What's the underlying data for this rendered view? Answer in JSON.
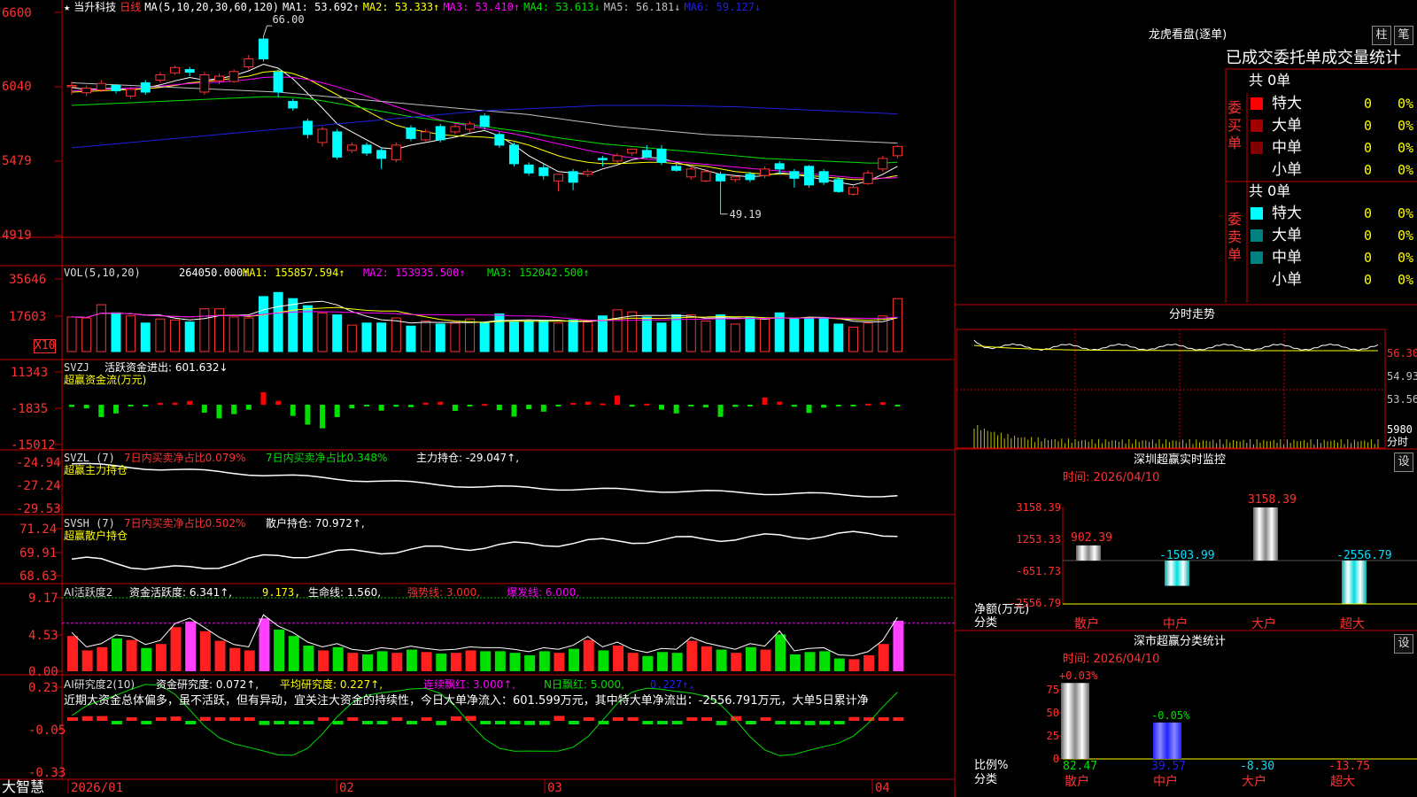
{
  "colors": {
    "up": "#ff3232",
    "down": "#00ffff",
    "ma1": "#ffffff",
    "ma2": "#ffff00",
    "ma3": "#ff00ff",
    "ma4": "#00e000",
    "ma5": "#c0c0c0",
    "ma6": "#2020e0",
    "grid": "#c00000",
    "label": "#ff3232"
  },
  "main_header": {
    "star": "★",
    "stock": "当升科技",
    "period": "日线",
    "ma_params": "MA(5,10,20,30,60,120)",
    "ma1": "MA1: 53.692↑",
    "ma2": "MA2: 53.333↑",
    "ma3": "MA3: 53.410↑",
    "ma4": "MA4: 53.613↓",
    "ma5": "MA5: 56.181↓",
    "ma6": "MA6: 59.127↓",
    "high_mark": "66.00",
    "low_mark": "49.19"
  },
  "vol_header": {
    "name": "VOL(5,10,20)",
    "v": "264050.000↑",
    "ma1": "MA1: 155857.594↑",
    "ma2": "MA2: 153935.500↑",
    "ma3": "MA3: 152042.500↑",
    "unit": "X10"
  },
  "svzj_header": {
    "name": "SVZJ",
    "label": "活跃资金进出: 601.632↓",
    "sub": "超赢资金流(万元)"
  },
  "svzl_header": {
    "name": "SVZL (7)",
    "a": "7日内买卖净占比0.079%",
    "b": "7日内买卖净占比0.348%",
    "c": "主力持仓: -29.047↑,",
    "sub": "超赢主力持仓"
  },
  "svsh_header": {
    "name": "SVSH (7)",
    "a": "7日内买卖净占比0.502%",
    "c": "散户持仓: 70.972↑,",
    "sub": "超赢散户持仓"
  },
  "ai1_header": {
    "name": "AI活跃度2",
    "a": "资金活跃度: 6.341↑,",
    "b": "9.173,",
    "c": "生命线: 1.560,",
    "d": "强势线: 3.000,",
    "e": "爆发线: 6.000,"
  },
  "ai2_header": {
    "name": "AI研究度2(10)",
    "a": "资金研究度: 0.072↑,",
    "b": "平均研究度: 0.227↑,",
    "c": "连续飘红: 3.000↑,",
    "d": "N日飘红: 5.000,",
    "e": "0.227↑,"
  },
  "ai2_text": "近期大资金总体偏多，虽不活跃，但有异动，宜关注大资金的持续性，今日大单净流入：601.599万元，其中特大单净流出：-2556.791万元，大单5日累计净",
  "y_axes": {
    "main": [
      "6600",
      "6040",
      "5479",
      "4919"
    ],
    "vol": [
      "35646",
      "17603"
    ],
    "svzj": [
      "11343",
      "-1835",
      "-15012"
    ],
    "svzl": [
      "-24.94",
      "-27.24",
      "-29.53"
    ],
    "svsh": [
      "71.24",
      "69.91",
      "68.63"
    ],
    "ai1": [
      "9.17",
      "4.53",
      "0.00"
    ],
    "ai2": [
      "0.23",
      "-0.05",
      "-0.33"
    ]
  },
  "x_axis": {
    "brand": "大智慧",
    "ticks": [
      "2026/01",
      "02",
      "03",
      "04"
    ]
  },
  "lhb": {
    "title": "龙虎看盘(逐单)",
    "btn1": "柱",
    "btn2": "笔",
    "sub": "已成交委托单成交量统计",
    "buy_total": "共 0单",
    "sell_total": "共 0单",
    "buy_label": "委买单",
    "sell_label": "委卖单",
    "rows": [
      {
        "name": "特大",
        "n": "0",
        "p": "0%"
      },
      {
        "name": "大单",
        "n": "0",
        "p": "0%"
      },
      {
        "name": "中单",
        "n": "0",
        "p": "0%"
      },
      {
        "name": "小单",
        "n": "0",
        "p": "0%"
      }
    ]
  },
  "intraday": {
    "title": "分时走势",
    "prices": [
      "56.30",
      "54.93",
      "53.56"
    ],
    "vol": "5980",
    "vol_unit": "分时"
  },
  "sz_monitor": {
    "title": "深圳超赢实时监控",
    "btn": "设",
    "date": "时间: 2026/04/10",
    "ticks": [
      "3158.39",
      "1253.33",
      "-651.73",
      "-2556.79"
    ],
    "y_label": "净额(万元)",
    "x_label": "分类",
    "categories": [
      "散户",
      "中户",
      "大户",
      "超大"
    ],
    "values": [
      902.39,
      -1503.99,
      3158.39,
      -2556.79
    ],
    "value_labels": [
      "902.39",
      "-1503.99",
      "3158.39",
      "-2556.79"
    ]
  },
  "sz_class": {
    "title": "深市超赢分类统计",
    "btn": "设",
    "date": "时间: 2026/04/10",
    "ticks": [
      "75",
      "50",
      "25",
      "0"
    ],
    "y_label": "比例%",
    "x_label": "分类",
    "categories": [
      "散户",
      "中户",
      "大户",
      "超大"
    ],
    "top_labels": [
      "+0.03%",
      "-0.05%"
    ],
    "values": [
      82.47,
      39.57,
      -8.3,
      -13.75
    ],
    "value_labels": [
      "82.47",
      "39.57",
      "-8.30",
      "-13.75"
    ]
  },
  "chart_data": {
    "type": "candlestick",
    "title": "当升科技 日线",
    "ylim": [
      4919,
      6600
    ],
    "x_ticks": [
      "2026/01",
      "02",
      "03",
      "04"
    ],
    "candles": [
      [
        6040,
        6050,
        5980,
        6080
      ],
      [
        5995,
        6030,
        5970,
        6050
      ],
      [
        6015,
        6065,
        6000,
        6090
      ],
      [
        6050,
        6010,
        5990,
        6060
      ],
      [
        5970,
        6020,
        5950,
        6040
      ],
      [
        6070,
        6000,
        5980,
        6090
      ],
      [
        6090,
        6130,
        6070,
        6150
      ],
      [
        6145,
        6185,
        6130,
        6200
      ],
      [
        6170,
        6150,
        6120,
        6190
      ],
      [
        6000,
        6130,
        5980,
        6150
      ],
      [
        6085,
        6120,
        6060,
        6140
      ],
      [
        6080,
        6155,
        6070,
        6170
      ],
      [
        6190,
        6250,
        6170,
        6280
      ],
      [
        6400,
        6250,
        6230,
        6420
      ],
      [
        6150,
        6000,
        5960,
        6170
      ],
      [
        5930,
        5880,
        5860,
        5950
      ],
      [
        5780,
        5680,
        5650,
        5800
      ],
      [
        5620,
        5720,
        5590,
        5740
      ],
      [
        5700,
        5510,
        5490,
        5720
      ],
      [
        5560,
        5600,
        5540,
        5620
      ],
      [
        5600,
        5540,
        5520,
        5620
      ],
      [
        5560,
        5500,
        5420,
        5580
      ],
      [
        5490,
        5600,
        5470,
        5620
      ],
      [
        5730,
        5650,
        5630,
        5750
      ],
      [
        5640,
        5700,
        5630,
        5720
      ],
      [
        5740,
        5640,
        5620,
        5760
      ],
      [
        5700,
        5740,
        5680,
        5760
      ],
      [
        5720,
        5760,
        5700,
        5780
      ],
      [
        5820,
        5740,
        5720,
        5840
      ],
      [
        5680,
        5600,
        5580,
        5700
      ],
      [
        5600,
        5460,
        5440,
        5620
      ],
      [
        5450,
        5390,
        5370,
        5470
      ],
      [
        5430,
        5370,
        5340,
        5460
      ],
      [
        5330,
        5380,
        5250,
        5360
      ],
      [
        5400,
        5320,
        5260,
        5420
      ],
      [
        5380,
        5400,
        5360,
        5420
      ],
      [
        5500,
        5490,
        5440,
        5520
      ],
      [
        5480,
        5520,
        5460,
        5540
      ],
      [
        5540,
        5570,
        5520,
        5560
      ],
      [
        5560,
        5510,
        5500,
        5600
      ],
      [
        5570,
        5470,
        5450,
        5600
      ],
      [
        5440,
        5410,
        5400,
        5460
      ],
      [
        5360,
        5420,
        5340,
        5440
      ],
      [
        5330,
        5400,
        5320,
        5420
      ],
      [
        5380,
        5330,
        5080,
        5400
      ],
      [
        5340,
        5360,
        5320,
        5360
      ],
      [
        5380,
        5340,
        5320,
        5400
      ],
      [
        5370,
        5420,
        5350,
        5440
      ],
      [
        5460,
        5420,
        5380,
        5480
      ],
      [
        5400,
        5350,
        5280,
        5420
      ],
      [
        5440,
        5300,
        5280,
        5450
      ],
      [
        5400,
        5320,
        5300,
        5420
      ],
      [
        5340,
        5250,
        5240,
        5360
      ],
      [
        5230,
        5280,
        5220,
        5300
      ],
      [
        5310,
        5390,
        5300,
        5410
      ],
      [
        5420,
        5500,
        5400,
        5520
      ],
      [
        5520,
        5590,
        5500,
        5600
      ]
    ],
    "volume": [
      17000,
      16500,
      23000,
      19000,
      17500,
      14000,
      16000,
      15500,
      14500,
      21000,
      21000,
      17000,
      16500,
      27000,
      29000,
      26000,
      22500,
      19000,
      18000,
      13000,
      14000,
      14000,
      16500,
      12500,
      15000,
      13500,
      14000,
      16000,
      14000,
      18500,
      14500,
      15000,
      15000,
      14000,
      15500,
      14500,
      17500,
      20500,
      19500,
      17000,
      14000,
      18000,
      18000,
      15000,
      18000,
      13500,
      17000,
      16000,
      19000,
      16000,
      16500,
      16500,
      13500,
      12000,
      14000,
      17500,
      26000
    ],
    "svzj": [
      -900,
      -1500,
      -5000,
      -3500,
      -200,
      -500,
      700,
      800,
      1500,
      -3200,
      -5500,
      -3800,
      -2000,
      5000,
      1500,
      -4500,
      -8000,
      -9500,
      -5000,
      -1500,
      -500,
      -2400,
      -800,
      -1000,
      800,
      1200,
      -2500,
      -400,
      300,
      -2200,
      -4800,
      -1800,
      -2800,
      -500,
      700,
      1200,
      500,
      3700,
      -800,
      400,
      -2000,
      -3500,
      -700,
      -1100,
      -4900,
      -900,
      -700,
      2900,
      1200,
      -800,
      -3300,
      -1200,
      -400,
      -500,
      400,
      1000,
      -200
    ],
    "series": [
      {
        "name": "MA1",
        "values": [
          6035,
          6020,
          6025,
          6030,
          6015,
          6030,
          6055,
          6085,
          6110,
          6090,
          6100,
          6125,
          6160,
          6210,
          6180,
          6100,
          5990,
          5880,
          5760,
          5700,
          5640,
          5580,
          5570,
          5600,
          5620,
          5640,
          5660,
          5690,
          5710,
          5670,
          5600,
          5520,
          5460,
          5400,
          5390,
          5380,
          5420,
          5450,
          5490,
          5510,
          5500,
          5470,
          5440,
          5410,
          5380,
          5370,
          5360,
          5370,
          5390,
          5380,
          5360,
          5340,
          5320,
          5300,
          5330,
          5380,
          5440
        ]
      },
      {
        "name": "MA2",
        "values": [
          6000,
          6005,
          6010,
          6015,
          6020,
          6025,
          6035,
          6050,
          6070,
          6080,
          6090,
          6105,
          6120,
          6150,
          6160,
          6140,
          6100,
          6040,
          5980,
          5920,
          5860,
          5800,
          5750,
          5720,
          5700,
          5680,
          5670,
          5665,
          5660,
          5650,
          5630,
          5600,
          5560,
          5520,
          5490,
          5470,
          5460,
          5460,
          5465,
          5470,
          5470,
          5460,
          5450,
          5440,
          5420,
          5400,
          5390,
          5380,
          5380,
          5380,
          5370,
          5360,
          5350,
          5340,
          5340,
          5350,
          5370
        ]
      },
      {
        "name": "MA3",
        "values": [
          6010,
          6015,
          6020,
          6025,
          6030,
          6035,
          6045,
          6055,
          6065,
          6070,
          6075,
          6085,
          6095,
          6110,
          6115,
          6110,
          6095,
          6070,
          6040,
          6005,
          5970,
          5930,
          5890,
          5855,
          5820,
          5790,
          5765,
          5745,
          5725,
          5705,
          5685,
          5660,
          5635,
          5610,
          5585,
          5560,
          5540,
          5520,
          5505,
          5495,
          5485,
          5475,
          5465,
          5455,
          5445,
          5435,
          5425,
          5415,
          5405,
          5395,
          5385,
          5375,
          5365,
          5355,
          5350,
          5350,
          5355
        ]
      },
      {
        "name": "MA4",
        "values": [
          5900,
          5905,
          5910,
          5915,
          5920,
          5925,
          5930,
          5935,
          5940,
          5945,
          5950,
          5955,
          5960,
          5965,
          5965,
          5960,
          5950,
          5935,
          5915,
          5895,
          5875,
          5855,
          5835,
          5815,
          5800,
          5785,
          5770,
          5755,
          5740,
          5725,
          5710,
          5695,
          5675,
          5655,
          5640,
          5625,
          5610,
          5600,
          5590,
          5580,
          5570,
          5560,
          5550,
          5540,
          5530,
          5520,
          5510,
          5500,
          5495,
          5490,
          5485,
          5480,
          5475,
          5470,
          5465,
          5465,
          5470
        ]
      },
      {
        "name": "MA5",
        "values": [
          6070,
          6065,
          6060,
          6055,
          6050,
          6045,
          6040,
          6035,
          6030,
          6025,
          6020,
          6015,
          6010,
          6005,
          6000,
          5990,
          5980,
          5970,
          5960,
          5950,
          5940,
          5930,
          5920,
          5910,
          5900,
          5890,
          5880,
          5870,
          5860,
          5850,
          5840,
          5830,
          5815,
          5800,
          5785,
          5770,
          5755,
          5740,
          5730,
          5720,
          5710,
          5700,
          5690,
          5680,
          5675,
          5670,
          5665,
          5660,
          5655,
          5650,
          5645,
          5640,
          5635,
          5630,
          5625,
          5620,
          5615
        ]
      },
      {
        "name": "MA6",
        "values": [
          5580,
          5590,
          5600,
          5610,
          5620,
          5630,
          5640,
          5650,
          5660,
          5670,
          5680,
          5690,
          5700,
          5710,
          5720,
          5730,
          5740,
          5750,
          5760,
          5770,
          5780,
          5790,
          5800,
          5810,
          5820,
          5830,
          5840,
          5850,
          5860,
          5865,
          5870,
          5875,
          5880,
          5885,
          5890,
          5895,
          5900,
          5900,
          5900,
          5900,
          5900,
          5898,
          5896,
          5894,
          5892,
          5890,
          5885,
          5880,
          5875,
          5870,
          5865,
          5860,
          5855,
          5850,
          5845,
          5840,
          5835
        ]
      }
    ]
  }
}
